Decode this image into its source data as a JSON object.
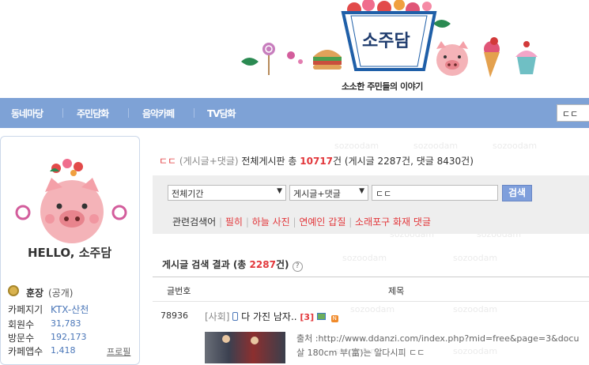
{
  "header": {
    "logo_text": "소주담",
    "slogan": "소소한 주민들의 이야기"
  },
  "nav": {
    "items": [
      "동네마당",
      "주민담화",
      "음악카페",
      "TV담화"
    ],
    "search_value": "ㄷㄷ"
  },
  "sidebar": {
    "hello_text": "HELLO, 소주담",
    "owner_label": "훈장",
    "owner_status": "(공개)",
    "stats": [
      {
        "label": "카페지기",
        "value": "KTX-산천"
      },
      {
        "label": "회원수",
        "value": "31,783"
      },
      {
        "label": "방문수",
        "value": "192,173"
      },
      {
        "label": "카페앱수",
        "value": "1,418"
      }
    ],
    "profile_link": "프로필"
  },
  "summary": {
    "query": "ㄷㄷ",
    "scope": "(게시글+댓글)",
    "board": "전체게시판 총",
    "total": "10717",
    "unit": "건",
    "breakdown": "(게시글 2287건, 댓글 8430건)"
  },
  "search": {
    "period": "전체기간",
    "type": "게시글+댓글",
    "query": "ㄷㄷ",
    "button": "검색",
    "related_label": "관련검색어",
    "related": [
      "필히",
      "하늘 사진",
      "연예인 갑질",
      "소래포구 화재 댓글"
    ]
  },
  "results": {
    "title_prefix": "게시글 검색 결과 (총",
    "count": "2287",
    "title_suffix": "건)",
    "help": "?",
    "col_number": "글번호",
    "col_title": "제목",
    "rows": [
      {
        "number": "78936",
        "category": "[사회]",
        "title": "다 가진 남자..",
        "comments": "[3]",
        "new_badge": "N",
        "excerpt1": "출처 :http://www.ddanzi.com/index.php?mid=free&page=3&docu",
        "excerpt2": "살 180cm 부(富)는 알다시피 ㄷㄷ"
      }
    ]
  },
  "watermark": "sozoodam",
  "colors": {
    "nav_bg": "#7ea2d6",
    "accent_red": "#e2373b",
    "search_button": "#7f9fdc",
    "panel_bg": "#eeeeee"
  }
}
